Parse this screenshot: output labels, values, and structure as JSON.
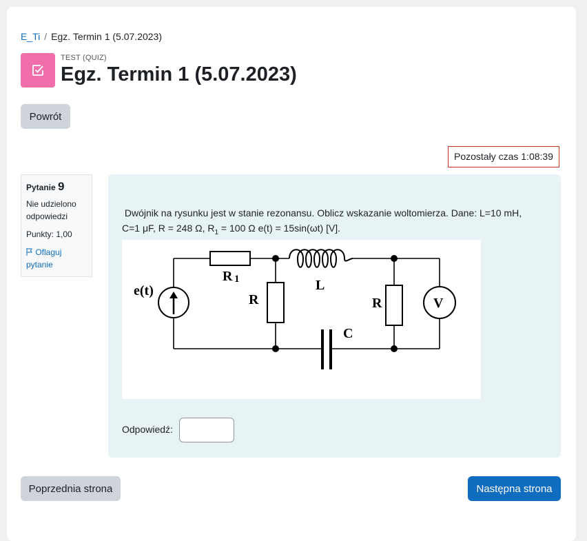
{
  "breadcrumb": {
    "course": "E_Ti",
    "separator": "/",
    "current": "Egz. Termin 1 (5.07.2023)"
  },
  "header": {
    "module_label": "TEST (QUIZ)",
    "title": "Egz. Termin 1 (5.07.2023)",
    "icon": "quiz-checkbox-icon"
  },
  "back_button": "Powrót",
  "timer": {
    "text": "Pozostały czas 1:08:39",
    "border_color": "#ca3120"
  },
  "question_info": {
    "label": "Pytanie",
    "number": "9",
    "state": "Nie udzielono odpowiedzi",
    "grade": "Punkty: 1,00",
    "flag_label": "Oflaguj pytanie"
  },
  "question": {
    "text_line1": "Dwójnik na rysunku jest w stanie rezonansu. Oblicz wskazanie woltomierza. Dane: L=10 mH,",
    "text_line2_a": "C=1 μF, R = 248 Ω, R",
    "text_line2_sub": "1",
    "text_line2_b": " = 100 Ω e(t) = 15sin(ωt) [V].",
    "answer_label": "Odpowiedź:",
    "answer_value": ""
  },
  "circuit": {
    "source_label": "e(t)",
    "r1_label": "R",
    "r1_sub": "1",
    "r_label": "R",
    "l_label": "L",
    "r2_label": "R",
    "c_label": "C",
    "meter_label": "V"
  },
  "nav": {
    "prev_label": "Poprzednia strona",
    "next_label": "Następna strona"
  },
  "colors": {
    "accent": "#0f6cbf",
    "quiz_icon_bg": "#f06eaa",
    "question_bg": "#e7f3f5"
  }
}
